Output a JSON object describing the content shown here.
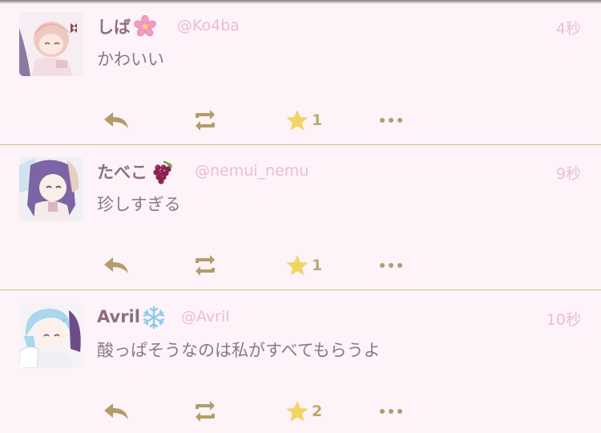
{
  "colors": {
    "background": "#fdf3f8",
    "name": "#8d6e80",
    "handle": "#ebbcd6",
    "content": "#8b7885",
    "action_icon": "#b39c68",
    "favourite_star": "#f1d463",
    "divider": "#cdbd8e"
  },
  "posts": [
    {
      "name": "しば",
      "name_emoji": "cherry-blossom-icon",
      "handle": "@Ko4ba",
      "time": "4秒",
      "content": "かわいい",
      "reply_icon": "reply-icon",
      "boost_icon": "boost-icon",
      "favourite_icon": "star-icon",
      "favourite_count": "1",
      "more_icon": "more-icon"
    },
    {
      "name": "たべこ",
      "name_emoji": "grapes-icon",
      "handle": "@nemui_nemu",
      "time": "9秒",
      "content": "珍しすぎる",
      "reply_icon": "reply-icon",
      "boost_icon": "boost-icon",
      "favourite_icon": "star-icon",
      "favourite_count": "1",
      "more_icon": "more-icon"
    },
    {
      "name": "Avril",
      "name_emoji": "snowflake-icon",
      "handle": "@Avril",
      "time": "10秒",
      "content": "酸っぱそうなのは私がすべてもらうよ",
      "reply_icon": "reply-icon",
      "boost_icon": "boost-icon",
      "favourite_icon": "star-icon",
      "favourite_count": "2",
      "more_icon": "more-icon"
    }
  ]
}
